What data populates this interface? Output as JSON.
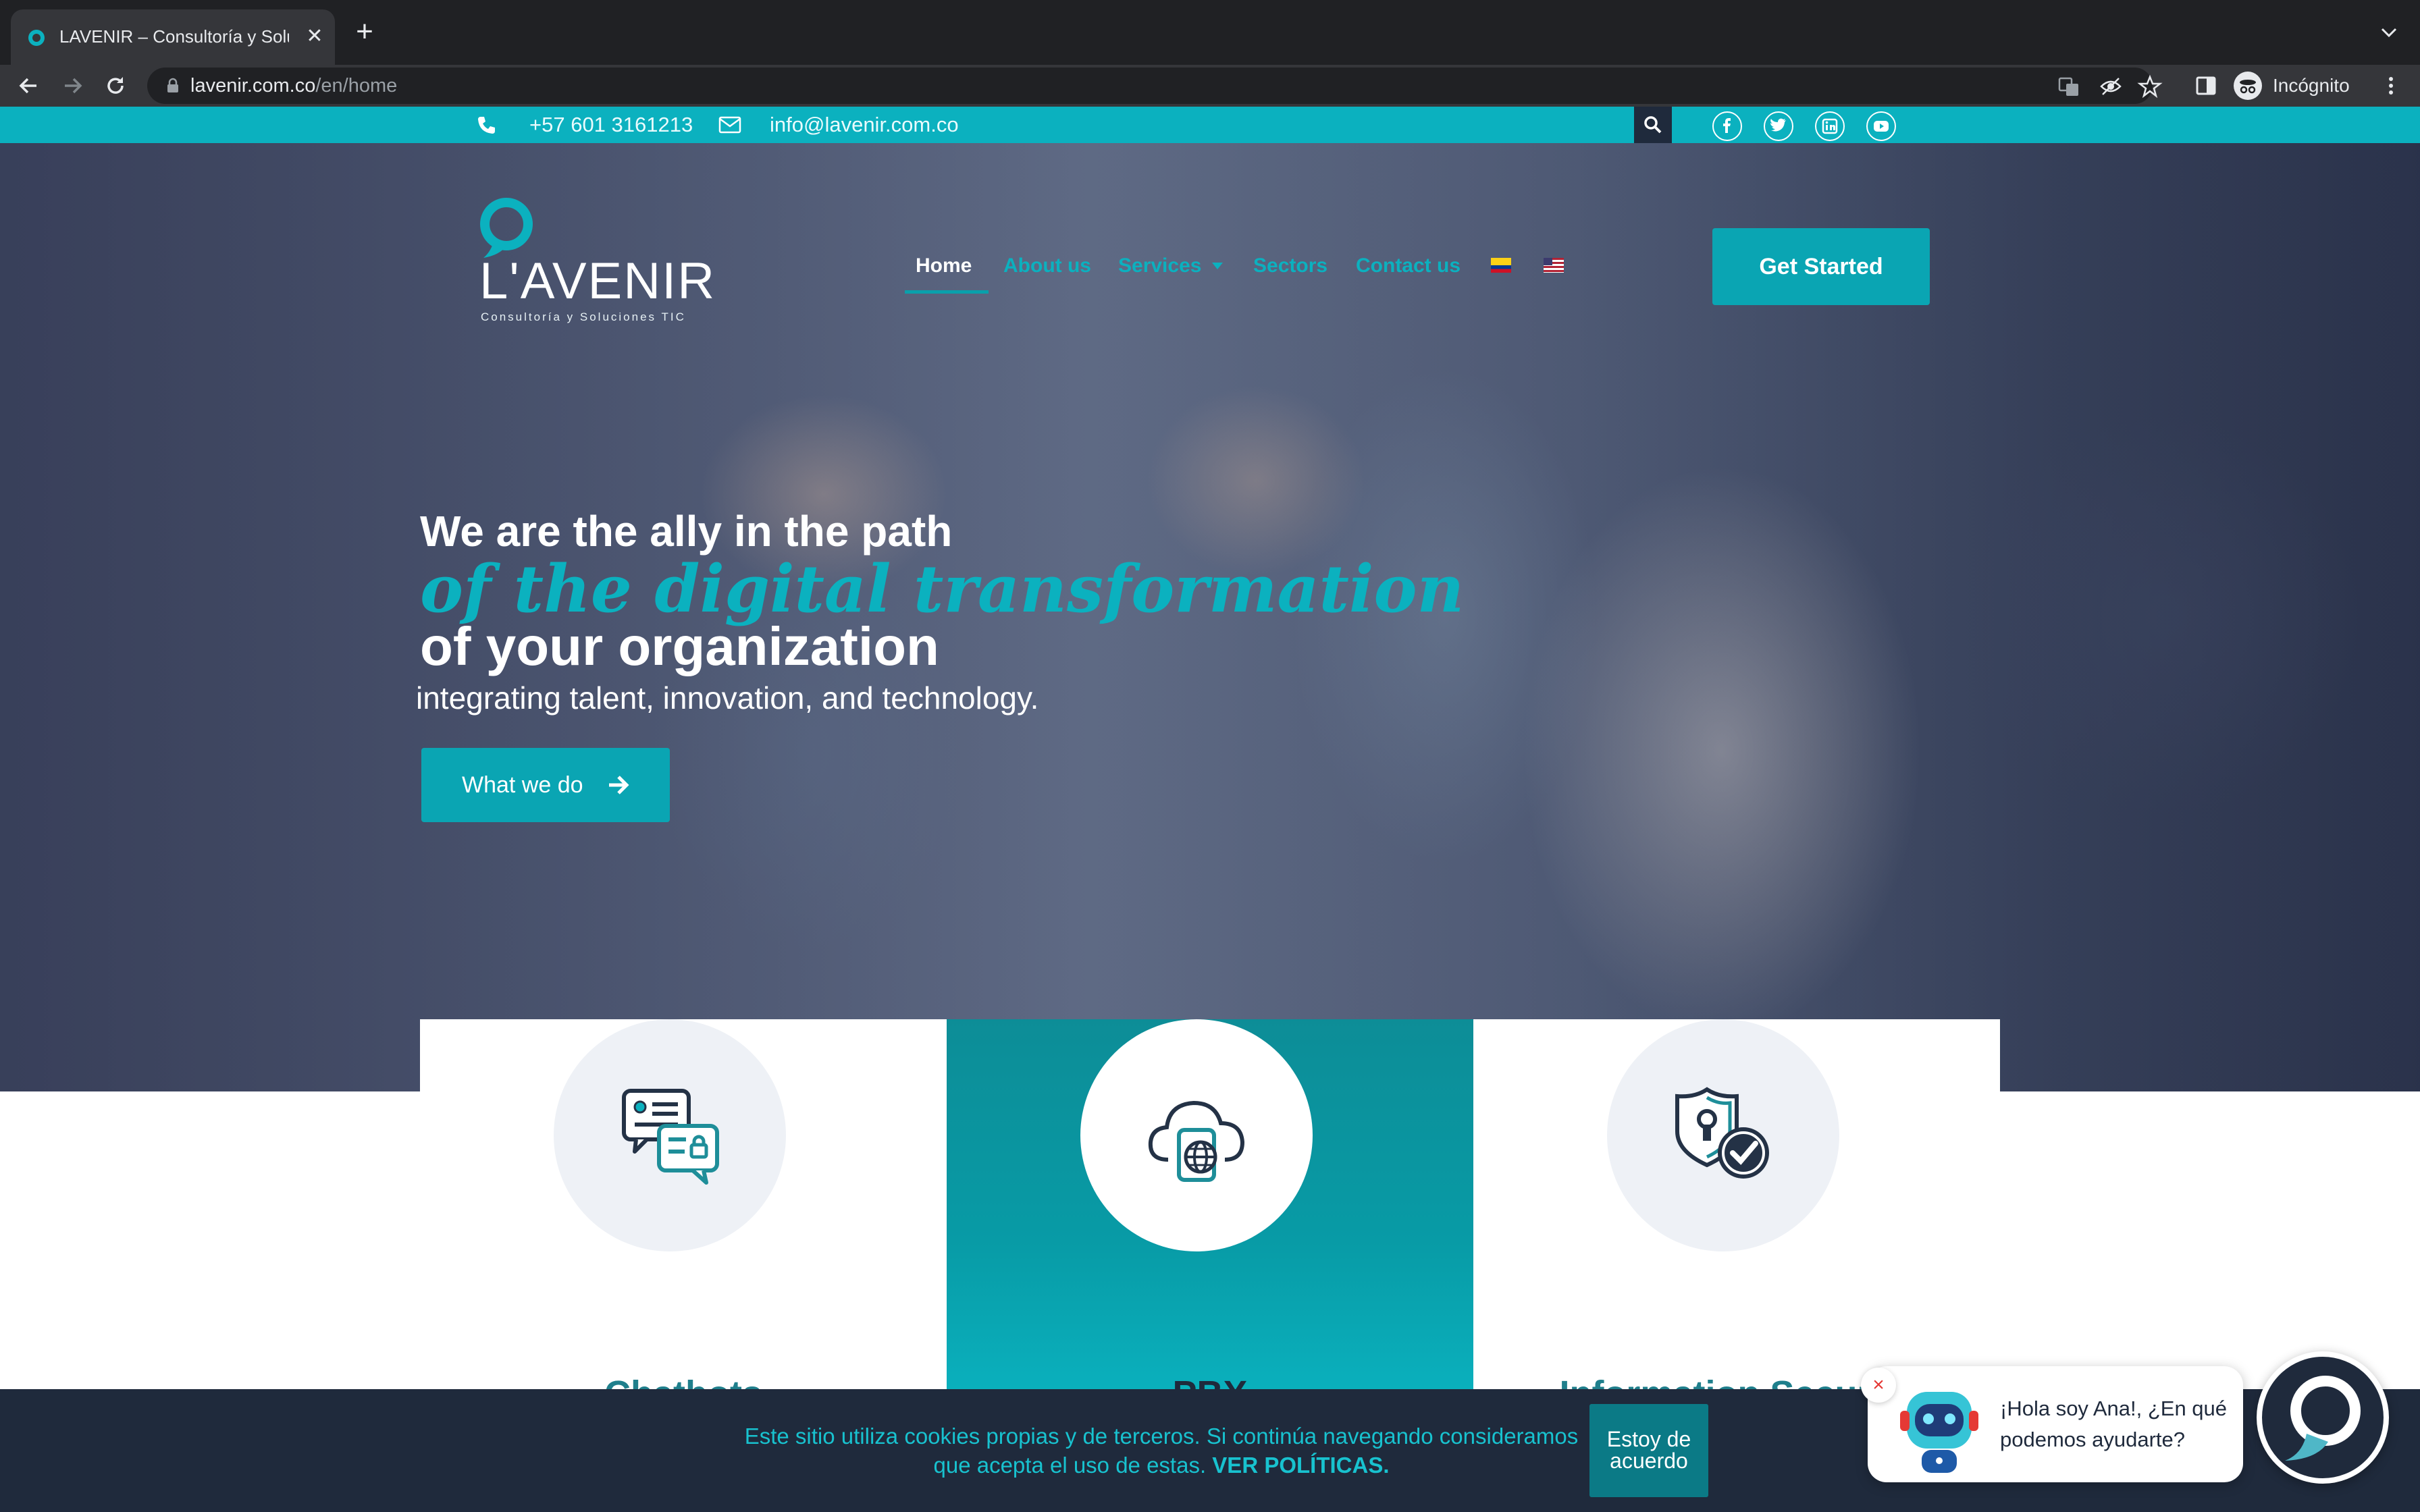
{
  "browser": {
    "tab_title": "LAVENIR – Consultoría y Solucio",
    "url_host": "lavenir.com.co",
    "url_path": "/en/home",
    "profile_label": "Incógnito"
  },
  "topbar": {
    "phone": "+57 601 3161213",
    "email": "info@lavenir.com.co",
    "social": [
      "facebook",
      "twitter",
      "linkedin",
      "youtube"
    ]
  },
  "header": {
    "logo_text": "L'AVENIR",
    "logo_subtitle": "Consultoría y Soluciones TIC",
    "nav": [
      {
        "label": "Home",
        "active": true
      },
      {
        "label": "About us"
      },
      {
        "label": "Services"
      },
      {
        "label": "Sectors"
      },
      {
        "label": "Contact us"
      }
    ],
    "languages": [
      "es",
      "en"
    ],
    "cta_label": "Get Started"
  },
  "hero": {
    "line1": "We are the ally in the path",
    "line2": "of the digital transformation",
    "line3": "of your organization",
    "line4": "integrating talent, innovation, and technology.",
    "button_label": "What we do"
  },
  "cards": [
    {
      "title": "Chatbots",
      "icon": "chat-document-icon"
    },
    {
      "title": "PBX",
      "icon": "cloud-globe-icon"
    },
    {
      "title": "Information Security",
      "icon": "shield-check-icon"
    }
  ],
  "cookie": {
    "text": "Este sitio utiliza cookies propias y de terceros. Si continúa navegando consideramos que acepta el uso de estas.",
    "link_label": "VER POLÍTICAS.",
    "button_label": "Estoy de acuerdo"
  },
  "chat": {
    "message": "¡Hola soy Ana!, ¿En qué podemos ayudarte?",
    "close_glyph": "×"
  },
  "colors": {
    "accent": "#0bb1bf",
    "dark": "#1f2a3c",
    "button": "#0aa5b3"
  }
}
